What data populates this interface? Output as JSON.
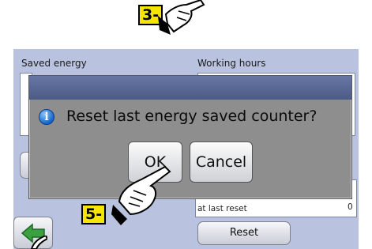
{
  "step_badges": {
    "top": "3-",
    "bottom": "5-"
  },
  "screen": {
    "left_header": "Saved energy",
    "right_header": "Working hours",
    "right_row_label": "at last reset",
    "right_row_value": "0",
    "reset_label": "Reset"
  },
  "dialog": {
    "icon": "info-icon",
    "message": "Reset last energy saved counter?",
    "ok_label": "OK",
    "cancel_label": "Cancel"
  },
  "colors": {
    "screen_bg": "#b9c3df",
    "title_bar": "#5a6896",
    "dialog_bg": "#8e8e8e",
    "badge": "#f5e600",
    "back_arrow": "#3aa040"
  }
}
